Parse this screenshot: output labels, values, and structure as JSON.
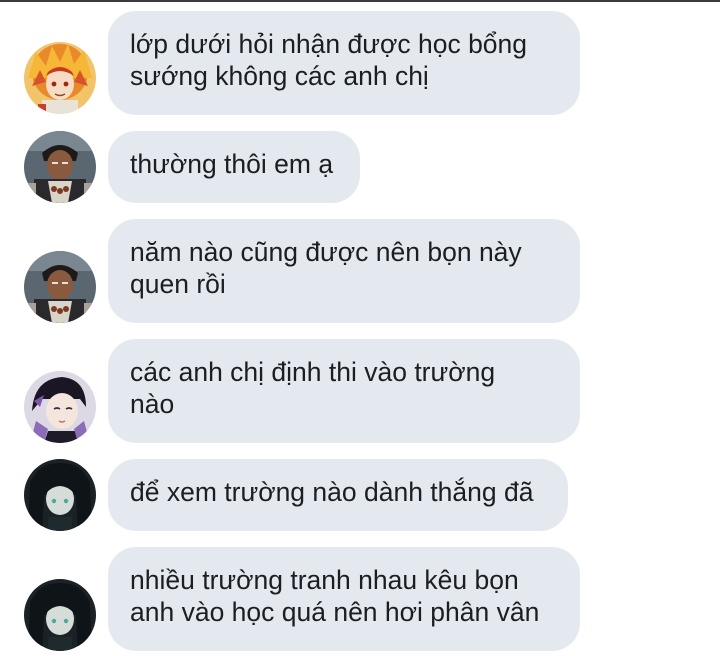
{
  "messages": [
    {
      "id": 1,
      "avatar": "avatar-rengoku-icon",
      "lines": [
        "lớp dưới hỏi nhận được học bổng",
        "sướng không các anh chị"
      ]
    },
    {
      "id": 2,
      "avatar": "avatar-gyomei-icon",
      "lines": [
        "thường thôi em ạ"
      ]
    },
    {
      "id": 3,
      "avatar": "avatar-gyomei-icon",
      "lines": [
        "năm nào cũng được nên bọn này",
        "quen rồi"
      ]
    },
    {
      "id": 4,
      "avatar": "avatar-shinobu-icon",
      "lines": [
        "các anh chị định thi vào trường",
        "nào"
      ]
    },
    {
      "id": 5,
      "avatar": "avatar-muichiro-icon",
      "lines": [
        "để xem trường nào dành thắng đã"
      ]
    },
    {
      "id": 6,
      "avatar": "avatar-muichiro-icon",
      "lines": [
        "nhiều trường tranh nhau kêu bọn",
        "anh vào học quá nên hơi phân vân"
      ]
    }
  ],
  "colors": {
    "bubble": "#e4e9ef",
    "text": "#1c1e21",
    "background": "#ffffff"
  }
}
